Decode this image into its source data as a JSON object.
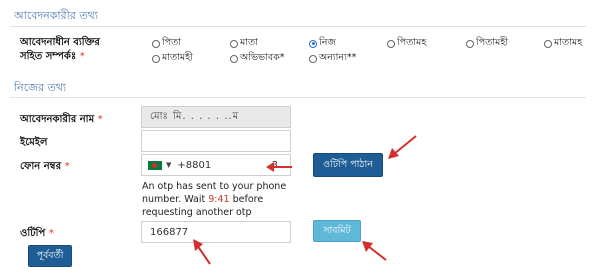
{
  "sections": {
    "applicant_info_title": "আবেদনকারীর তথ্য",
    "own_info_title": "নিজের তথ্য"
  },
  "relationship": {
    "label_line1": "আবেদনাধীন ব্যক্তির",
    "label_line2": "সহিত সম্পর্কঃ",
    "required_mark": "*",
    "options": [
      {
        "label": "পিতা",
        "selected": false
      },
      {
        "label": "মাতা",
        "selected": false
      },
      {
        "label": "নিজ",
        "selected": true
      },
      {
        "label": "পিতামহ",
        "selected": false
      },
      {
        "label": "পিতামহী",
        "selected": false
      },
      {
        "label": "মাতামহ",
        "selected": false
      },
      {
        "label": "মাতামহী",
        "selected": false
      },
      {
        "label": "অভিভাবক*",
        "selected": false
      },
      {
        "label": "অন্যান্য**",
        "selected": false
      }
    ]
  },
  "form": {
    "name_label": "আবেদনকারীর নাম",
    "name_value": "মোঃ মি. . . . . ..ম",
    "email_label": "ইমেইল",
    "email_value": "",
    "phone_label": "ফোন নম্বর",
    "phone_value": "+8801",
    "phone_value_tail": "3",
    "send_otp_button": "ওটিপি পাঠান",
    "otp_note_line1": "An otp has sent to your phone",
    "otp_note_line2_pre": "number. Wait",
    "otp_timer": "9:41",
    "otp_note_line2_post": "before",
    "otp_note_line3": "requesting another otp",
    "otp_label": "ওটিপি",
    "otp_value": "166877",
    "submit_button": "সাবমিট",
    "previous_button": "পূর্ববর্তী",
    "required_mark": "*"
  },
  "colors": {
    "section_title": "#4a7bb0",
    "arrow": "#d32f2f",
    "primary_button": "#1f5d96",
    "submit_button": "#5fb8d8",
    "timer": "#c0392b"
  }
}
